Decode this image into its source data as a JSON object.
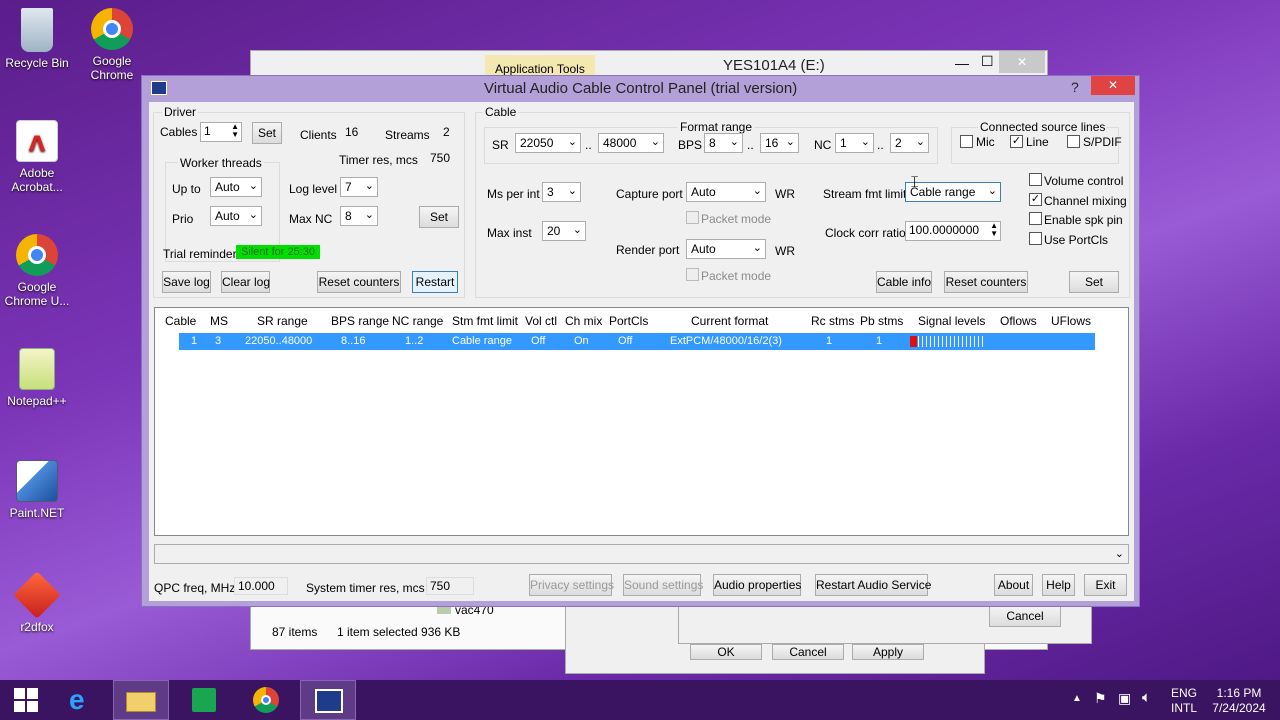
{
  "desktop": {
    "icons": [
      {
        "label": "Recycle Bin"
      },
      {
        "label": "Google Chrome"
      },
      {
        "label": "Adobe Acrobat..."
      },
      {
        "label": "Google Chrome U..."
      },
      {
        "label": "Notepad++"
      },
      {
        "label": "Paint.NET"
      },
      {
        "label": "r2dfox"
      }
    ]
  },
  "background_window": {
    "ribbon_tab": "Application Tools",
    "title": "YES101A4 (E:)",
    "status_items": "87 items",
    "status_selected": "1 item selected  936 KB",
    "file_name": "vac470",
    "dialog_cancel": "Cancel",
    "dialog_ok": "OK",
    "dialog_cancel2": "Cancel",
    "dialog_apply": "Apply"
  },
  "vac": {
    "title": "Virtual Audio Cable Control Panel (trial version)",
    "help_glyph": "?",
    "close_glyph": "✕",
    "driver": {
      "group_label": "Driver",
      "cables_label": "Cables",
      "cables_value": "1",
      "set_label": "Set",
      "clients_label": "Clients",
      "clients_value": "16",
      "streams_label": "Streams",
      "streams_value": "2",
      "timer_label": "Timer res, mcs",
      "timer_value": "750",
      "worker_threads_label": "Worker threads",
      "upto_label": "Up to",
      "upto_value": "Auto",
      "prio_label": "Prio",
      "prio_value": "Auto",
      "loglevel_label": "Log level",
      "loglevel_value": "7",
      "maxnc_label": "Max NC",
      "maxnc_value": "8",
      "set2_label": "Set",
      "trial_label": "Trial reminder",
      "trial_value": "Silent for 25:30",
      "save_log": "Save log",
      "clear_log": "Clear log",
      "reset_counters": "Reset counters",
      "restart": "Restart"
    },
    "cable": {
      "group_label": "Cable",
      "format_range_label": "Format range",
      "sr_label": "SR",
      "sr_from": "22050",
      "sr_to": "48000",
      "dots": "..",
      "bps_label": "BPS",
      "bps_from": "8",
      "bps_to": "16",
      "nc_label": "NC",
      "nc_from": "1",
      "nc_to": "2",
      "connected_label": "Connected source lines",
      "mic_label": "Mic",
      "line_label": "Line",
      "spdif_label": "S/PDIF",
      "ms_per_int_label": "Ms per int",
      "ms_per_int_value": "3",
      "max_inst_label": "Max inst",
      "max_inst_value": "20",
      "capture_port_label": "Capture port",
      "capture_port_value": "Auto",
      "wr1": "WR",
      "packet_mode1": "Packet mode",
      "render_port_label": "Render port",
      "render_port_value": "Auto",
      "wr2": "WR",
      "packet_mode2": "Packet mode",
      "stream_fmt_label": "Stream fmt limit",
      "stream_fmt_value": "Cable range",
      "clock_corr_label": "Clock corr ratio",
      "clock_corr_value": "100.0000000",
      "volume_control": "Volume control",
      "channel_mixing": "Channel mixing",
      "enable_spk_pin": "Enable spk pin",
      "use_portcls": "Use PortCls",
      "cable_info": "Cable info",
      "reset_counters": "Reset counters",
      "set_label": "Set"
    },
    "table": {
      "headers": [
        "Cable",
        "MS",
        "SR range",
        "BPS range",
        "NC range",
        "Stm fmt limit",
        "Vol ctl",
        "Ch mix",
        "PortCls",
        "Current format",
        "Rc stms",
        "Pb stms",
        "Signal levels",
        "Oflows",
        "UFlows"
      ],
      "rows": [
        [
          "1",
          "3",
          "22050..48000",
          "8..16",
          "1..2",
          "Cable range",
          "Off",
          "On",
          "Off",
          "ExtPCM/48000/16/2(3)",
          "1",
          "1",
          "",
          "",
          ""
        ]
      ]
    },
    "bottom": {
      "qpc_label": "QPC freq, MHz",
      "qpc_value": "10.000",
      "systimer_label": "System timer res, mcs",
      "systimer_value": "750",
      "privacy": "Privacy settings",
      "sound": "Sound settings",
      "audio_props": "Audio properties",
      "restart_service": "Restart Audio Service",
      "about": "About",
      "help": "Help",
      "exit": "Exit"
    }
  },
  "taskbar": {
    "lang": "ENG",
    "layout": "INTL",
    "time": "1:16 PM",
    "date": "7/24/2024"
  },
  "colors": {
    "trial_green": "#00e000",
    "selection_blue": "#3399ff",
    "signal_red": "#e01010"
  }
}
